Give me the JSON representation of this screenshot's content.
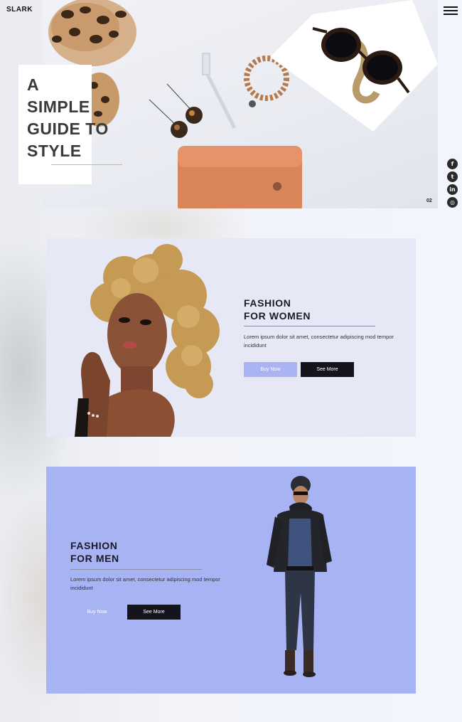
{
  "brand": "SLARK",
  "icons": {
    "menu": "hamburger-icon",
    "social": [
      "facebook-icon",
      "twitter-icon",
      "linkedin-icon",
      "instagram-icon"
    ]
  },
  "social_glyphs": [
    "f",
    "t",
    "in",
    "◎"
  ],
  "hero": {
    "title_lines": [
      "A",
      "SIMPLE",
      "GUIDE TO",
      "STYLE"
    ],
    "slide_number": "02"
  },
  "women": {
    "title_line1": "FASHION",
    "title_line2": "FOR WOMEN",
    "text": "Lorem ipsum dolor sit amet, consectetur adipiscing mod tempor incididunt",
    "buy_label": "Buy Now",
    "more_label": "See More"
  },
  "men": {
    "title_line1": "FASHION",
    "title_line2": "FOR MEN",
    "text": "Lorem ipsum dolor sit amet, consectetur adipiscing mod tempor incididunt",
    "buy_label": "Buy Now",
    "more_label": "See More"
  },
  "colors": {
    "page_bg": "#eef1fa",
    "women_card": "#e6e8f6",
    "men_card": "#a8b3f3",
    "accent_button": "#aab3f3",
    "dark_button": "#14151c"
  }
}
